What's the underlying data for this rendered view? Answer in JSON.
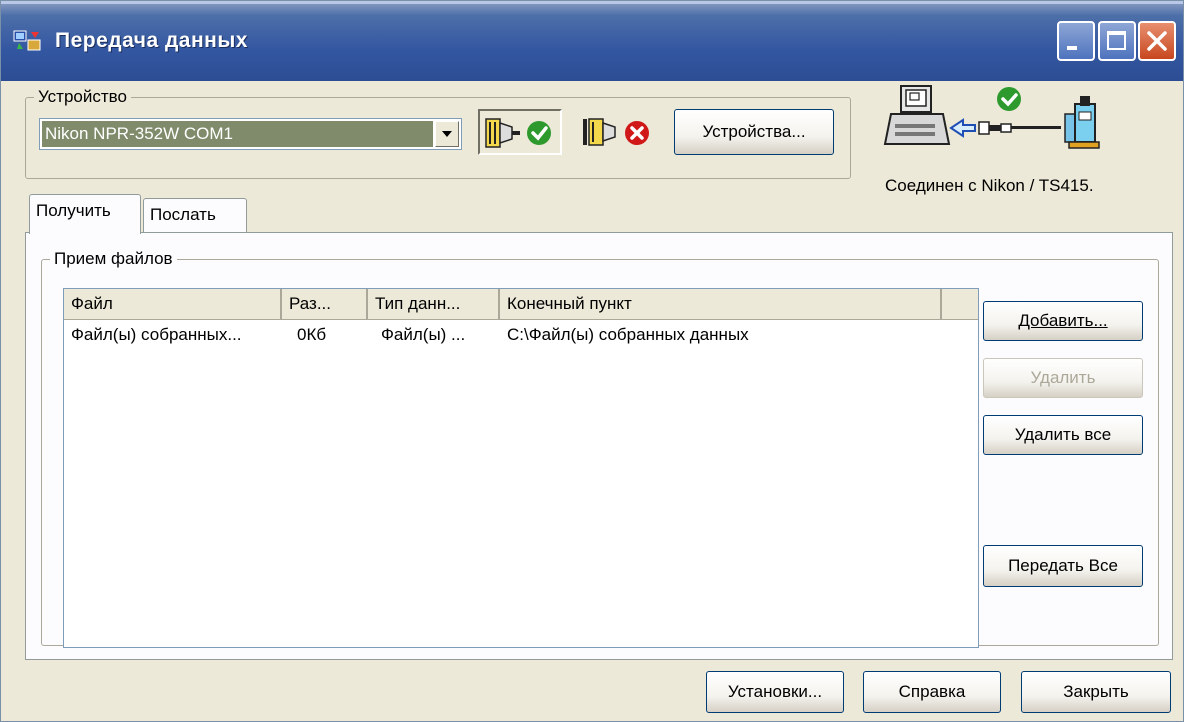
{
  "window": {
    "title": "Передача данных",
    "controls": {
      "minimize": "minimize-icon",
      "maximize": "maximize-icon",
      "close": "close-icon"
    }
  },
  "device": {
    "group_label": "Устройство",
    "selected": "Nikon NPR-352W COM1",
    "connect_icon": "connect-icon",
    "disconnect_icon": "disconnect-icon",
    "devices_button": "Устройства...",
    "status": "Соединен с Nikon / TS415.",
    "graphic_icon": "computer-to-total-station-link-icon"
  },
  "tabs": [
    {
      "label": "Получить",
      "active": true
    },
    {
      "label": "Послать",
      "active": false
    }
  ],
  "receive": {
    "group_label": "Прием файлов",
    "columns": [
      "Файл",
      "Раз...",
      "Тип данн...",
      "Конечный пункт"
    ],
    "rows": [
      [
        "Файл(ы) собранных...",
        "0Кб",
        "Файл(ы) ...",
        "C:\\Файл(ы) собранных данных"
      ]
    ],
    "buttons": {
      "add": "Добавить...",
      "delete": "Удалить",
      "delete_all": "Удалить все",
      "transfer_all": "Передать Все"
    }
  },
  "footer": {
    "settings": "Установки...",
    "help": "Справка",
    "close": "Закрыть"
  },
  "colors": {
    "title_bar": "#3457a2",
    "dialog_bg": "#ece9d8",
    "combo_selection": "#7f8b6a",
    "ok_green": "#2e9a2e",
    "error_red": "#d01818"
  }
}
